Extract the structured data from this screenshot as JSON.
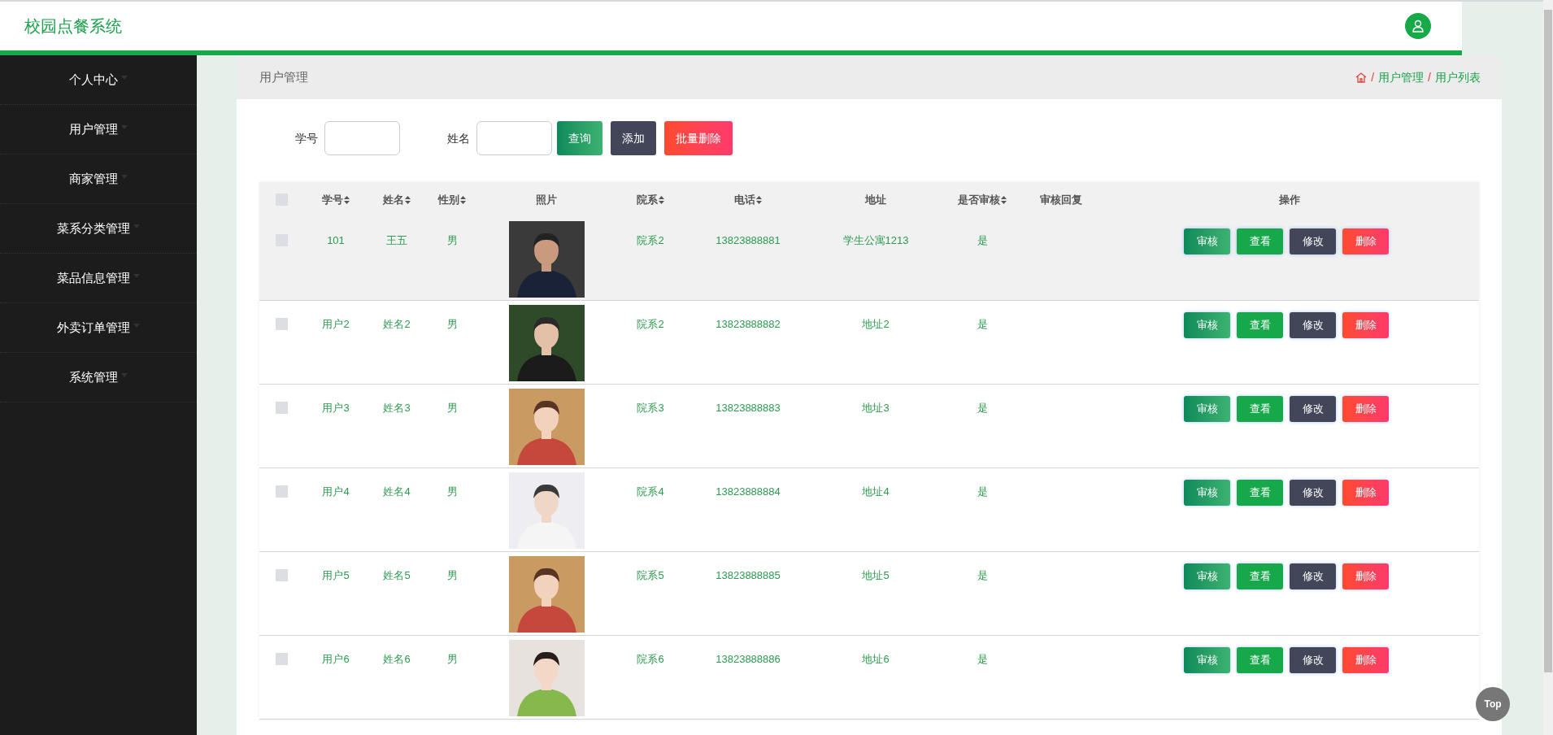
{
  "header": {
    "title": "校园点餐系统"
  },
  "sidebar": {
    "items": [
      {
        "label": "个人中心"
      },
      {
        "label": "用户管理"
      },
      {
        "label": "商家管理"
      },
      {
        "label": "菜系分类管理"
      },
      {
        "label": "菜品信息管理"
      },
      {
        "label": "外卖订单管理"
      },
      {
        "label": "系统管理"
      }
    ]
  },
  "page_title": "用户管理",
  "breadcrumb": [
    {
      "separator": "/",
      "label": "用户管理"
    },
    {
      "separator": "/",
      "label": "用户列表"
    }
  ],
  "search": {
    "fields": [
      {
        "label": "学号"
      },
      {
        "label": "姓名"
      }
    ],
    "buttons": [
      {
        "label": "查询",
        "kind": "query"
      },
      {
        "label": "添加",
        "kind": "add"
      },
      {
        "label": "批量删除",
        "kind": "delete"
      }
    ]
  },
  "table": {
    "select_all_checked": false,
    "columns": [
      {
        "label": "学号",
        "sortable": true
      },
      {
        "label": "姓名",
        "sortable": true
      },
      {
        "label": "性别",
        "sortable": true
      },
      {
        "label": "照片",
        "sortable": false
      },
      {
        "label": "院系",
        "sortable": true
      },
      {
        "label": "电话",
        "sortable": true
      },
      {
        "label": "地址",
        "sortable": false
      },
      {
        "label": "是否审核",
        "sortable": true
      },
      {
        "label": "审核回复",
        "sortable": false
      },
      {
        "label": "操作",
        "sortable": false
      }
    ],
    "rows": [
      {
        "hovered": true,
        "checked": false,
        "cells": [
          "101",
          "王五",
          "男",
          {
            "kind": "picture"
          },
          "院系2",
          "13823888881",
          "学生公寓1213",
          "是",
          ""
        ],
        "actions": [
          {
            "label": "审核",
            "kind": "review"
          },
          {
            "label": "查看",
            "kind": "view"
          },
          {
            "label": "修改",
            "kind": "edit"
          },
          {
            "label": "删除",
            "kind": "delete"
          }
        ]
      },
      {
        "hovered": false,
        "checked": false,
        "cells": [
          "用户2",
          "姓名2",
          "男",
          {
            "kind": "picture"
          },
          "院系2",
          "13823888882",
          "地址2",
          "是",
          ""
        ],
        "actions": [
          {
            "label": "审核",
            "kind": "review"
          },
          {
            "label": "查看",
            "kind": "view"
          },
          {
            "label": "修改",
            "kind": "edit"
          },
          {
            "label": "删除",
            "kind": "delete"
          }
        ]
      },
      {
        "hovered": false,
        "checked": false,
        "cells": [
          "用户3",
          "姓名3",
          "男",
          {
            "kind": "picture"
          },
          "院系3",
          "13823888883",
          "地址3",
          "是",
          ""
        ],
        "actions": [
          {
            "label": "审核",
            "kind": "review"
          },
          {
            "label": "查看",
            "kind": "view"
          },
          {
            "label": "修改",
            "kind": "edit"
          },
          {
            "label": "删除",
            "kind": "delete"
          }
        ]
      },
      {
        "hovered": false,
        "checked": false,
        "cells": [
          "用户4",
          "姓名4",
          "男",
          {
            "kind": "picture"
          },
          "院系4",
          "13823888884",
          "地址4",
          "是",
          ""
        ],
        "actions": [
          {
            "label": "审核",
            "kind": "review"
          },
          {
            "label": "查看",
            "kind": "view"
          },
          {
            "label": "修改",
            "kind": "edit"
          },
          {
            "label": "删除",
            "kind": "delete"
          }
        ]
      },
      {
        "hovered": false,
        "checked": false,
        "cells": [
          "用户5",
          "姓名5",
          "男",
          {
            "kind": "picture"
          },
          "院系5",
          "13823888885",
          "地址5",
          "是",
          ""
        ],
        "actions": [
          {
            "label": "审核",
            "kind": "review"
          },
          {
            "label": "查看",
            "kind": "view"
          },
          {
            "label": "修改",
            "kind": "edit"
          },
          {
            "label": "删除",
            "kind": "delete"
          }
        ]
      },
      {
        "hovered": false,
        "checked": false,
        "cells": [
          "用户6",
          "姓名6",
          "男",
          {
            "kind": "picture"
          },
          "院系6",
          "13823888886",
          "地址6",
          "是",
          ""
        ],
        "actions": [
          {
            "label": "审核",
            "kind": "review"
          },
          {
            "label": "查看",
            "kind": "view"
          },
          {
            "label": "修改",
            "kind": "edit"
          },
          {
            "label": "删除",
            "kind": "delete"
          }
        ]
      }
    ]
  },
  "top_button": "Top"
}
